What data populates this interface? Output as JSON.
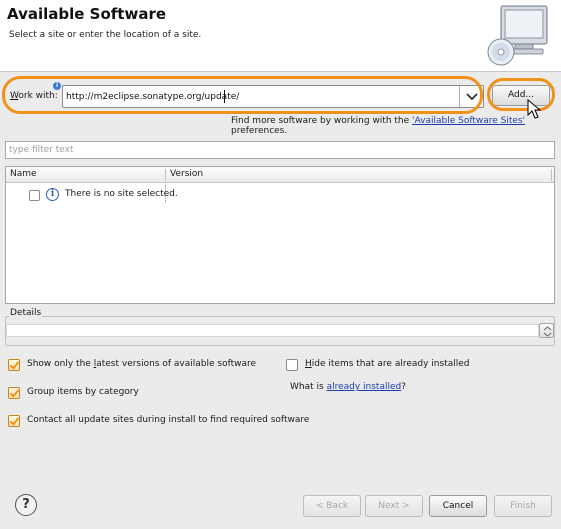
{
  "header": {
    "title": "Available Software",
    "subtitle": "Select a site or enter the location of a site."
  },
  "work_with": {
    "label_underlined": "W",
    "label_rest": "ork with:",
    "value": "http://m2eclipse.sonatype.org/update/",
    "add_button": "Add..."
  },
  "find_more": {
    "prefix": "Find more software by working with the ",
    "link": "'Available Software Sites'",
    "suffix": " preferences."
  },
  "filter": {
    "placeholder": "type filter text"
  },
  "table": {
    "columns": [
      "Name",
      "Version"
    ],
    "rows": [
      {
        "name": "There is no site selected.",
        "version": ""
      }
    ]
  },
  "details": {
    "label": "Details"
  },
  "options": {
    "latest_pre": "Show only the ",
    "latest_ul": "l",
    "latest_post": "atest versions of available software",
    "latest_checked": true,
    "group_pre": "Group items by category",
    "group_checked": true,
    "contact": "Contact all update sites during install to find required software",
    "contact_checked": true,
    "hide_pre": "",
    "hide_ul": "H",
    "hide_post": "ide items that are already installed",
    "hide_checked": false,
    "what_prefix": "What is ",
    "what_link": "already installed",
    "what_suffix": "?"
  },
  "footer": {
    "help": "?",
    "back": "< Back",
    "next": "Next >",
    "cancel": "Cancel",
    "finish": "Finish"
  },
  "colors": {
    "highlight": "#f0921a",
    "link": "#1b3fb0"
  },
  "icons": [
    "computer-cd-icon",
    "info-icon",
    "dropdown-arrow-icon",
    "mouse-cursor-icon",
    "help-icon"
  ]
}
